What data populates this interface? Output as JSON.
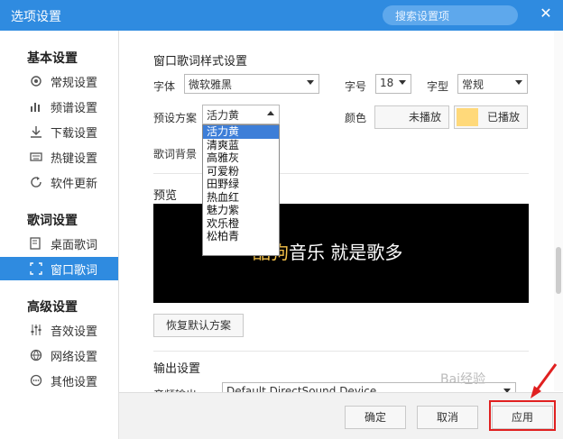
{
  "window": {
    "title": "选项设置",
    "search_placeholder": "搜索设置项"
  },
  "sidebar": {
    "sections": [
      {
        "title": "基本设置",
        "items": [
          "常规设置",
          "频谱设置",
          "下载设置",
          "热键设置",
          "软件更新"
        ]
      },
      {
        "title": "歌词设置",
        "items": [
          "桌面歌词",
          "窗口歌词"
        ]
      },
      {
        "title": "高级设置",
        "items": [
          "音效设置",
          "网络设置",
          "其他设置"
        ]
      }
    ],
    "active_item": "窗口歌词"
  },
  "main": {
    "lyrics_style": {
      "title": "窗口歌词样式设置",
      "font_label": "字体",
      "font_value": "微软雅黑",
      "size_label": "字号",
      "size_value": "18",
      "weight_label": "字型",
      "weight_value": "常规",
      "preset_label": "预设方案",
      "preset_value": "活力黄",
      "preset_options": [
        "活力黄",
        "清爽蓝",
        "高雅灰",
        "可爱粉",
        "田野绿",
        "热血红",
        "魅力紫",
        "欢乐橙",
        "松柏青"
      ],
      "color_label": "颜色",
      "unplayed_label": "未播放",
      "played_label": "已播放",
      "played_color": "#ffd97a",
      "bg_label": "歌词背景"
    },
    "preview": {
      "title": "预览",
      "text_highlight": "酷狗",
      "text_rest": "音乐 就是歌多"
    },
    "restore_button": "恢复默认方案",
    "output": {
      "title": "输出设置",
      "device_label": "音频输出",
      "device_value": "Default DirectSound Device"
    }
  },
  "footer": {
    "ok": "确定",
    "cancel": "取消",
    "apply": "应用"
  },
  "watermark": "Bai经验",
  "colors": {
    "accent": "#2f8be0",
    "highlight_red": "#e02020"
  }
}
